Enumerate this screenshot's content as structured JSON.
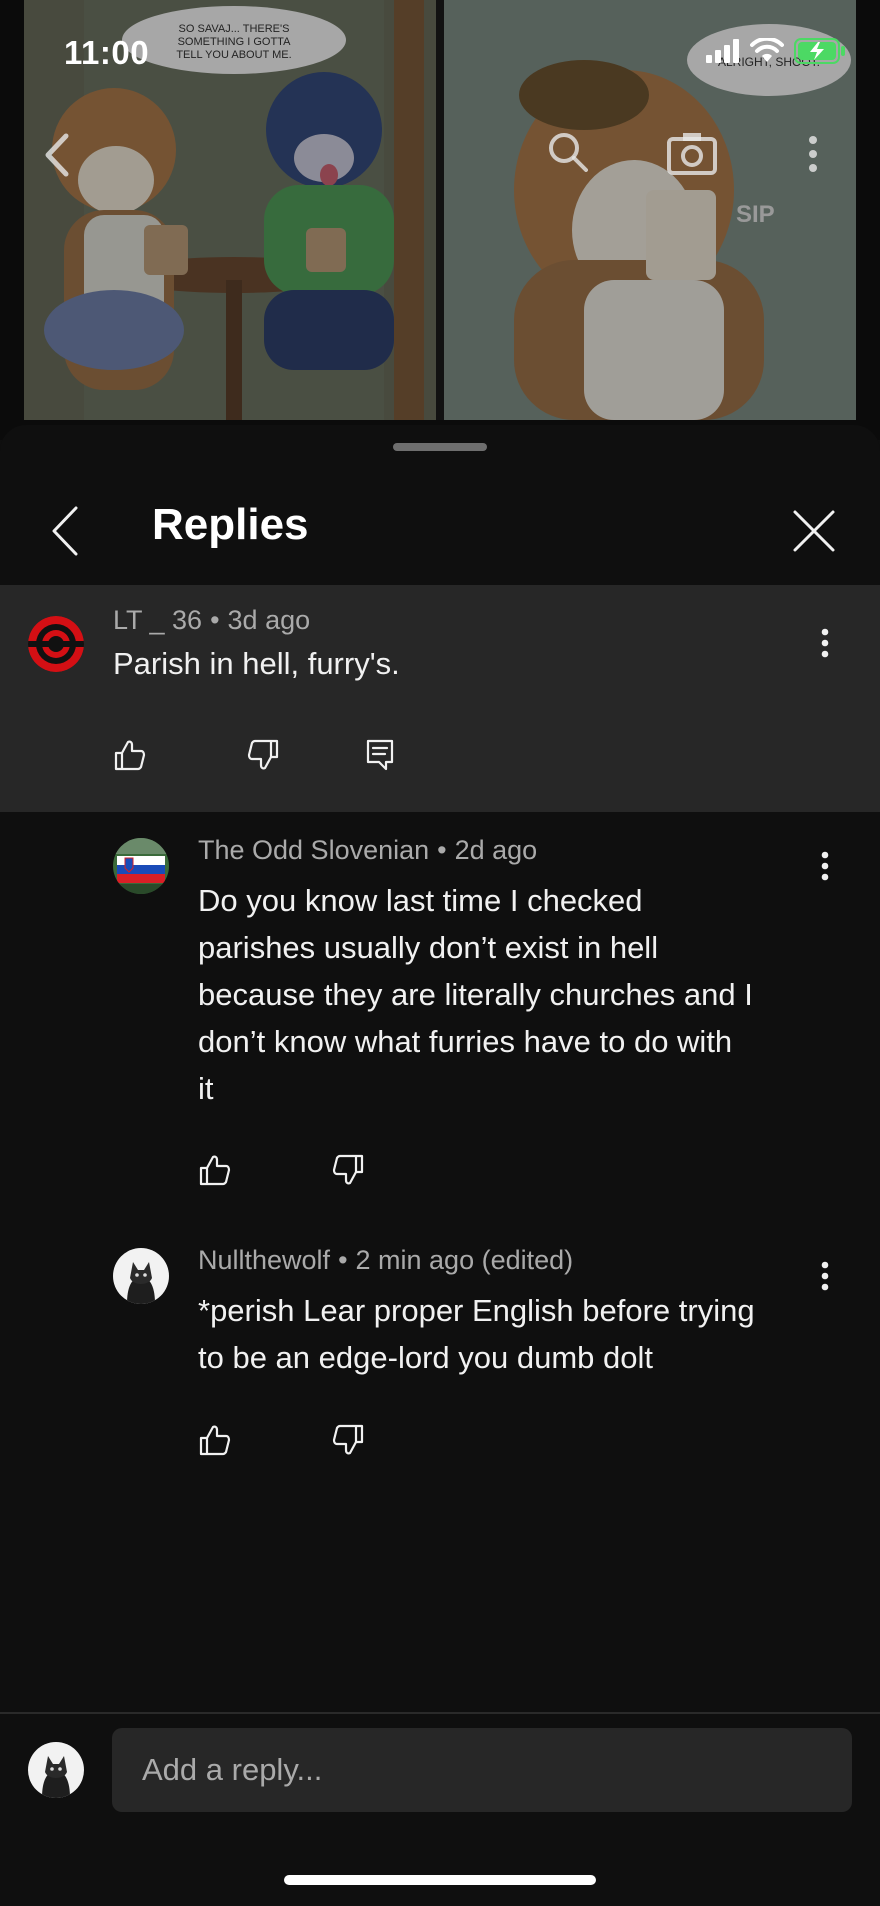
{
  "status_bar": {
    "time": "11:00"
  },
  "video": {
    "panel_text_1": "SO SAVAJ... THERE'S SOMETHING I GOTTA TELL YOU ABOUT ME.",
    "panel_text_2": "ALRIGHT, SHOOT.",
    "panel_sfx": "SIP"
  },
  "header": {
    "title": "Replies"
  },
  "parent_comment": {
    "author": "LT _ 36",
    "time": "3d ago",
    "text": "Parish in hell, furry's."
  },
  "replies": [
    {
      "author": "The Odd Slovenian",
      "time": "2d ago",
      "lines": [
        "Do you know last time I checked",
        "parishes usually don’t exist in hell",
        "because they are literally churches and I",
        "don’t know what furries have to do with",
        "it"
      ]
    },
    {
      "author": "Nullthewolf",
      "time": "2 min ago (edited)",
      "lines": [
        "*perish Lear proper English before trying",
        "to be an edge-lord you dumb dolt"
      ]
    }
  ],
  "composer": {
    "placeholder": "Add a reply..."
  },
  "icons": [
    "back-icon",
    "search-icon",
    "camera-icon",
    "more-icon",
    "chevron-left-icon",
    "close-icon",
    "kebab-icon",
    "like-icon",
    "dislike-icon",
    "reply-icon",
    "signal-icon",
    "wifi-icon",
    "battery-icon"
  ],
  "colors": {
    "background": "#0f0f0f",
    "surface": "#272727",
    "text": "#f1f1f1",
    "secondary_text": "#aaaaaa",
    "battery_green": "#4cd964"
  }
}
